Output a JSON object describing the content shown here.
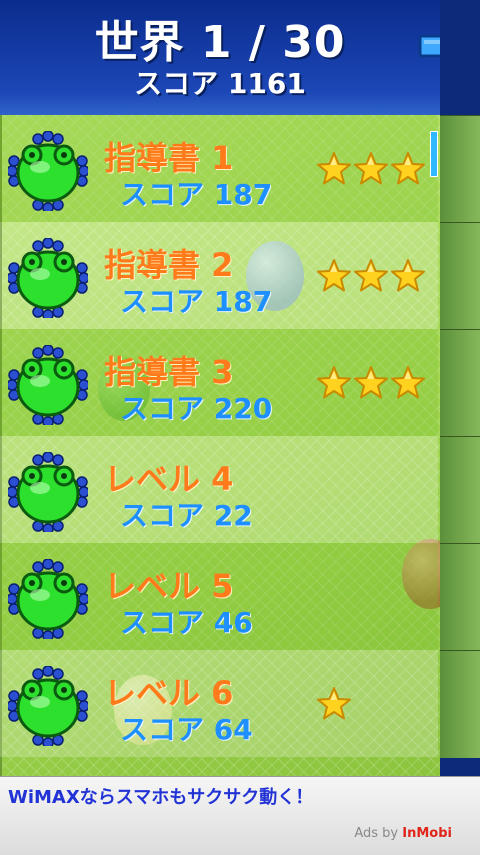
{
  "header": {
    "world_title": "世界 1 / 30",
    "world_score": "スコア 1161"
  },
  "levels": [
    {
      "name": "指導書 1",
      "score": "スコア 187",
      "stars": 3
    },
    {
      "name": "指導書 2",
      "score": "スコア 187",
      "stars": 3
    },
    {
      "name": "指導書 3",
      "score": "スコア 220",
      "stars": 3
    },
    {
      "name": "レベル 4",
      "score": "スコア 22",
      "stars": 0
    },
    {
      "name": "レベル 5",
      "score": "スコア 46",
      "stars": 0
    },
    {
      "name": "レベル 6",
      "score": "スコア 64",
      "stars": 1
    }
  ],
  "ad": {
    "text": "WiMAXならスマホもサクサク動く！",
    "by_label": "Ads by ",
    "by_brand": "InMobi"
  },
  "colors": {
    "level_name": "#ff7a1a",
    "level_score": "#1e8fff",
    "star": "#ffd21f",
    "frog": "#2ee02e"
  },
  "icons": {
    "next": "next-arrow-icon",
    "frog": "frog-icon",
    "star": "star-icon"
  }
}
